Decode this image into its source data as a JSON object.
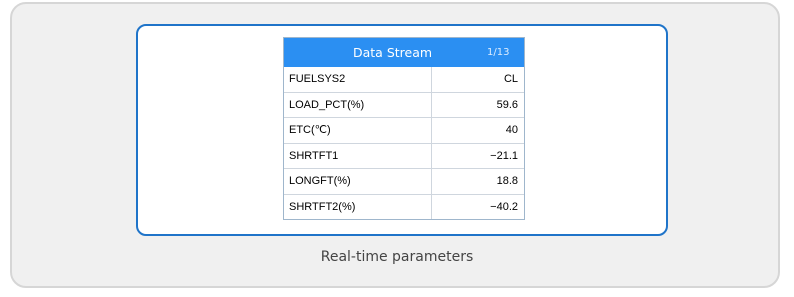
{
  "screen": {
    "title": "Data Stream",
    "page_indicator": "1/13",
    "rows": [
      {
        "name": "FUELSYS2",
        "value": "CL"
      },
      {
        "name": "LOAD_PCT(%)",
        "value": "59.6"
      },
      {
        "name": "ETC(℃)",
        "value": "40"
      },
      {
        "name": "SHRTFT1",
        "value": "−21.1"
      },
      {
        "name": "LONGFT(%)",
        "value": "18.8"
      },
      {
        "name": "SHRTFT2(%)",
        "value": "−40.2"
      }
    ]
  },
  "caption": "Real-time parameters",
  "colors": {
    "header": "#2b8ff2",
    "frame_border": "#1f74c9",
    "outer_background": "#f0f0f0"
  }
}
